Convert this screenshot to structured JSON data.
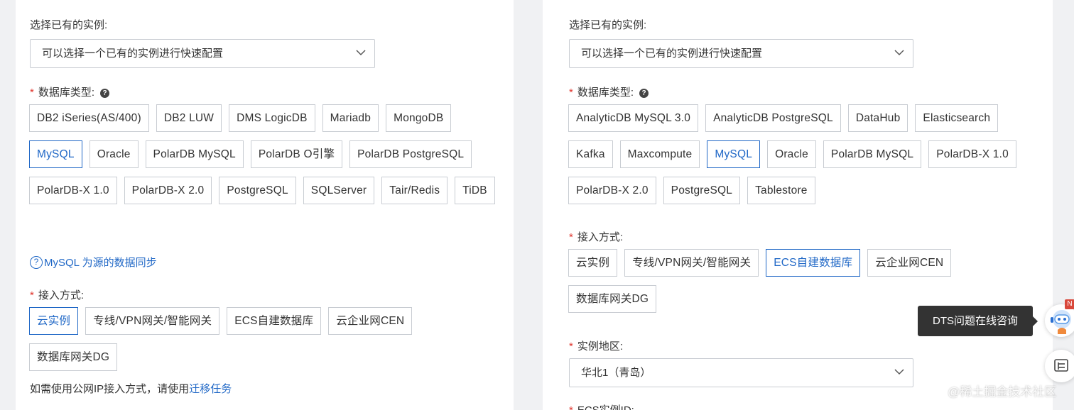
{
  "left": {
    "instance_label": "选择已有的实例:",
    "instance_placeholder": "可以选择一个已有的实例进行快速配置",
    "db_type_label": "数据库类型:",
    "db_types": [
      "DB2 iSeries(AS/400)",
      "DB2 LUW",
      "DMS LogicDB",
      "Mariadb",
      "MongoDB",
      "MySQL",
      "Oracle",
      "PolarDB MySQL",
      "PolarDB O引擎",
      "PolarDB PostgreSQL",
      "PolarDB-X 1.0",
      "PolarDB-X 2.0",
      "PostgreSQL",
      "SQLServer",
      "Tair/Redis",
      "TiDB"
    ],
    "db_type_selected": "MySQL",
    "sync_link": "MySQL 为源的数据同步",
    "access_label": "接入方式:",
    "access_types": [
      "云实例",
      "专线/VPN网关/智能网关",
      "ECS自建数据库",
      "云企业网CEN",
      "数据库网关DG"
    ],
    "access_selected": "云实例",
    "note_prefix": "如需使用公网IP接入方式，请使用",
    "note_link": "迁移任务"
  },
  "right": {
    "instance_label": "选择已有的实例:",
    "instance_placeholder": "可以选择一个已有的实例进行快速配置",
    "db_type_label": "数据库类型:",
    "db_types": [
      "AnalyticDB MySQL 3.0",
      "AnalyticDB PostgreSQL",
      "DataHub",
      "Elasticsearch",
      "Kafka",
      "Maxcompute",
      "MySQL",
      "Oracle",
      "PolarDB MySQL",
      "PolarDB-X 1.0",
      "PolarDB-X 2.0",
      "PostgreSQL",
      "Tablestore"
    ],
    "db_type_selected": "MySQL",
    "access_label": "接入方式:",
    "access_types": [
      "云实例",
      "专线/VPN网关/智能网关",
      "ECS自建数据库",
      "云企业网CEN",
      "数据库网关DG"
    ],
    "access_selected": "ECS自建数据库",
    "region_label": "实例地区:",
    "region_value": "华北1（青岛）",
    "ecs_label": "ECS实例ID:"
  },
  "tooltip": "DTS问题在线咨询",
  "badge": "N",
  "required_mark": "*",
  "help_glyph": "?",
  "watermark": "@稀土掘金技术社区",
  "colors": {
    "accent": "#1f67c6",
    "required": "#e0362e",
    "border": "#c8ccd2"
  },
  "icons": [
    "chevron-down-icon",
    "help-icon",
    "question-circle-icon",
    "robot-assistant-icon",
    "feedback-icon"
  ]
}
